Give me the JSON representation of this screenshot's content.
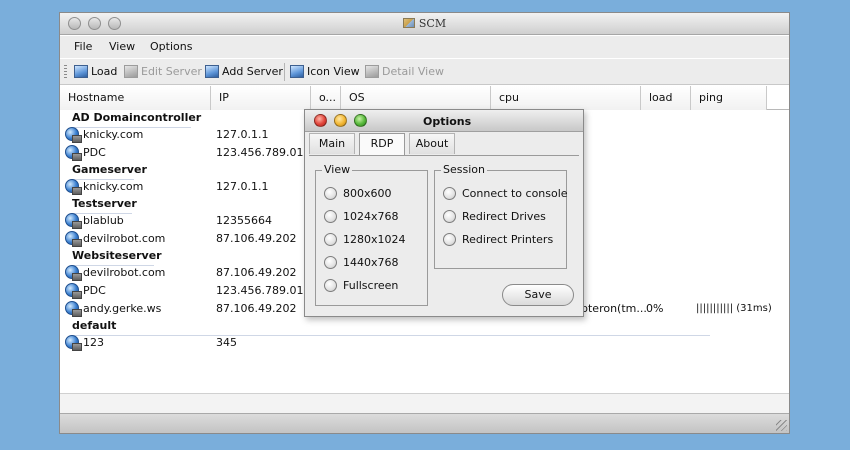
{
  "window": {
    "title": "SCM"
  },
  "menu": [
    "File",
    "View",
    "Options"
  ],
  "toolbar": {
    "load": "Load",
    "edit_server": "Edit Server",
    "add_server": "Add Server",
    "icon_view": "Icon View",
    "detail_view": "Detail View"
  },
  "columns": [
    "Hostname",
    "IP",
    "o...",
    "OS",
    "cpu",
    "load",
    "ping"
  ],
  "groups": [
    {
      "name": "AD Domaincontroller",
      "rows": [
        {
          "host": "knicky.com",
          "ip": "127.0.1.1"
        },
        {
          "host": "PDC",
          "ip": "123.456.789.012"
        }
      ]
    },
    {
      "name": "Gameserver",
      "rows": [
        {
          "host": "knicky.com",
          "ip": "127.0.1.1"
        }
      ]
    },
    {
      "name": "Testserver",
      "rows": [
        {
          "host": "blablub",
          "ip": "12355664"
        },
        {
          "host": "devilrobot.com",
          "ip": "87.106.49.202"
        }
      ]
    },
    {
      "name": "Websiteserver",
      "rows": [
        {
          "host": "devilrobot.com",
          "ip": "87.106.49.202"
        },
        {
          "host": "PDC",
          "ip": "123.456.789.012"
        },
        {
          "host": "andy.gerke.ws",
          "ip": "87.106.49.202",
          "cpu": "pteron(tm...",
          "load": "0%",
          "ping": "||||||||||| (31ms)"
        }
      ]
    },
    {
      "name": "default",
      "rows": [
        {
          "host": "123",
          "ip": "345"
        }
      ]
    }
  ],
  "dialog": {
    "title": "Options",
    "tabs": [
      "Main",
      "RDP",
      "About"
    ],
    "active_tab": "RDP",
    "view_legend": "View",
    "view_options": [
      "800x600",
      "1024x768",
      "1280x1024",
      "1440x768",
      "Fullscreen"
    ],
    "session_legend": "Session",
    "session_options": [
      "Connect to console",
      "Redirect Drives",
      "Redirect Printers"
    ],
    "save": "Save"
  }
}
